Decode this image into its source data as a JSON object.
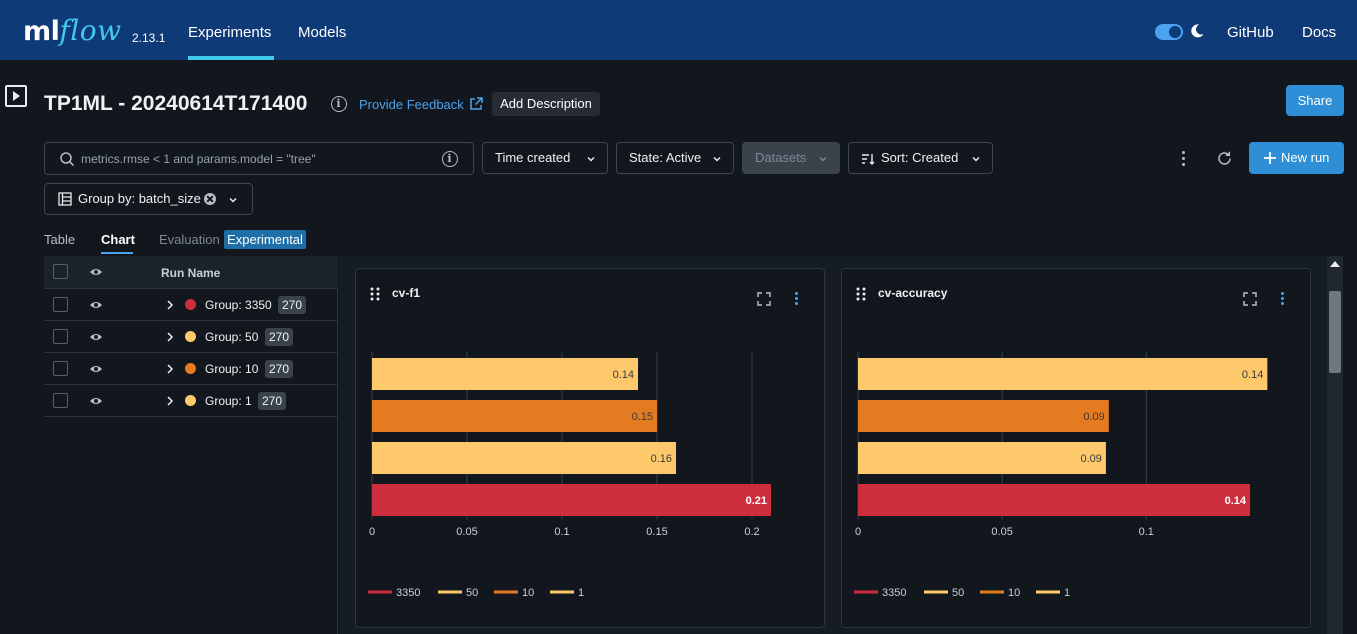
{
  "app": {
    "logo_ml": "ml",
    "logo_flow": "flow",
    "version": "2.13.1",
    "nav": [
      "Experiments",
      "Models"
    ],
    "nav_right": [
      "GitHub",
      "Docs"
    ]
  },
  "header": {
    "title": "TP1ML - 20240614T171400",
    "feedback_link": "Provide Feedback",
    "add_description": "Add Description",
    "share": "Share"
  },
  "filters": {
    "search_placeholder": "metrics.rmse < 1 and params.model = \"tree\"",
    "time_created": "Time created",
    "state": "State: Active",
    "datasets": "Datasets",
    "sort": "Sort: Created",
    "new_run": "New run",
    "group_by": "Group by: batch_size"
  },
  "tabs": {
    "table": "Table",
    "chart": "Chart",
    "evaluation": "Evaluation",
    "experimental": "Experimental"
  },
  "runs": {
    "column": "Run Name",
    "rows": [
      {
        "label": "Group: 3350",
        "count": "270",
        "color": "#cd2e3d"
      },
      {
        "label": "Group: 50",
        "count": "270",
        "color": "#fdc96a"
      },
      {
        "label": "Group: 10",
        "count": "270",
        "color": "#e47b20"
      },
      {
        "label": "Group: 1",
        "count": "270",
        "color": "#fdc96a"
      }
    ]
  },
  "colors": {
    "g3350": "#cd2e3d",
    "g50": "#fdc96a",
    "g10": "#e47b20",
    "g1": "#fdc96a",
    "accent": "#2e8ed6"
  },
  "chart_data": [
    {
      "type": "bar",
      "orientation": "horizontal",
      "title": "cv-f1",
      "categories": [
        "3350",
        "50",
        "10",
        "1"
      ],
      "values": [
        0.21,
        0.16,
        0.15,
        0.14
      ],
      "value_labels": [
        "0.21",
        "0.16",
        "0.15",
        "0.14"
      ],
      "xlim": [
        0,
        0.22
      ],
      "xticks": [
        0,
        0.05,
        0.1,
        0.15,
        0.2
      ],
      "xtick_labels": [
        "0",
        "0.05",
        "0.1",
        "0.15",
        "0.2"
      ],
      "legend": [
        "3350",
        "50",
        "10",
        "1"
      ],
      "legend_position": "bottom"
    },
    {
      "type": "bar",
      "orientation": "horizontal",
      "title": "cv-accuracy",
      "categories": [
        "3350",
        "50",
        "10",
        "1"
      ],
      "values": [
        0.136,
        0.086,
        0.087,
        0.142
      ],
      "value_labels": [
        "0.14",
        "0.09",
        "0.09",
        "0.14"
      ],
      "xlim": [
        0,
        0.145
      ],
      "xticks": [
        0,
        0.05,
        0.1
      ],
      "xtick_labels": [
        "0",
        "0.05",
        "0.1"
      ],
      "legend": [
        "3350",
        "50",
        "10",
        "1"
      ],
      "legend_position": "bottom"
    }
  ]
}
